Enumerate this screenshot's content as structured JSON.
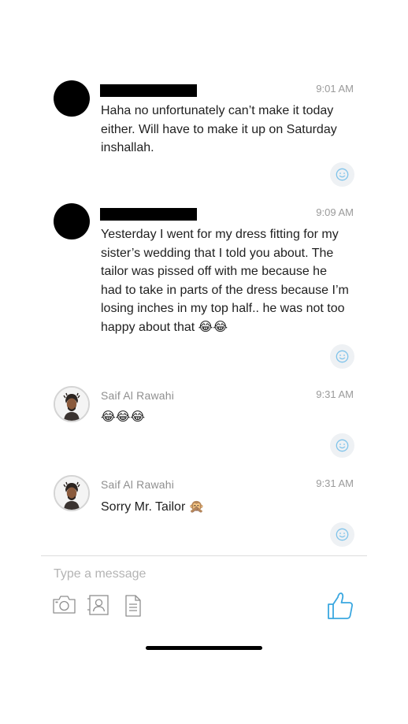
{
  "messages": [
    {
      "sender": "",
      "time": "9:01 AM",
      "text": "Haha no unfortunately can’t make it today\neither. Will have to make it up on Saturday\ninshallah."
    },
    {
      "sender": "",
      "time": "9:09 AM",
      "text": "Yesterday I went for my dress fitting for my\nsister’s wedding that I told you about. The\ntailor was pissed off with me because he\nhad to take in parts of the dress because I’m\nlosing inches in my top half.. he was not too\nhappy about that 😂😂"
    },
    {
      "sender": "Saif Al Rawahi",
      "time": "9:31 AM",
      "text": "😂😂😂"
    },
    {
      "sender": "Saif Al Rawahi",
      "time": "9:31 AM",
      "text": "Sorry Mr. Tailor 🙊"
    }
  ],
  "composer": {
    "placeholder": "Type a message",
    "icons": [
      "camera-icon",
      "contact-card-icon",
      "document-icon"
    ],
    "send_icon": "thumbs-up-icon"
  },
  "colors": {
    "accent": "#3aa7e0",
    "react_icon": "#7fc3ea",
    "react_bg": "#eef1f4",
    "meta_text": "#9a9a9a"
  }
}
